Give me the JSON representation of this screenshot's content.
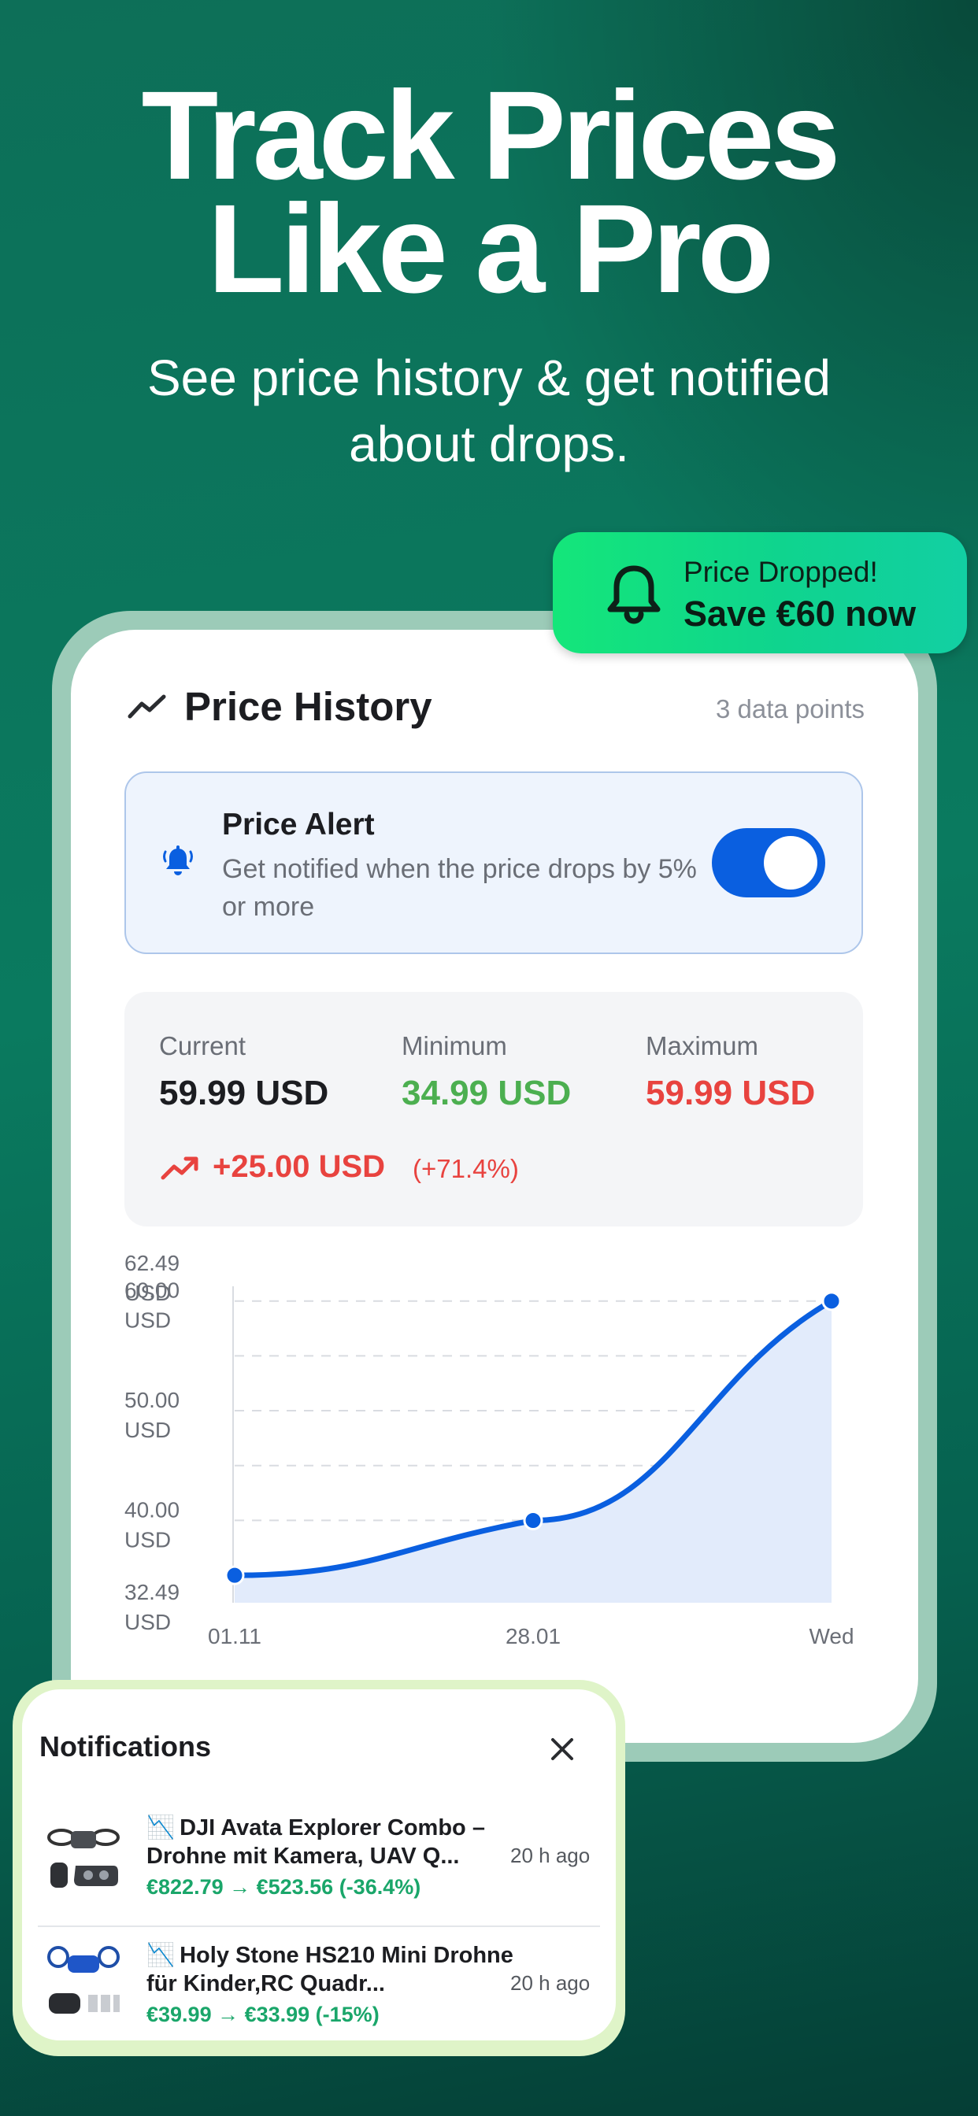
{
  "hero": {
    "title_line1": "Track Prices",
    "title_line2": "Like a Pro",
    "subtitle_line1": "See price history & get notified",
    "subtitle_line2": "about drops."
  },
  "badge": {
    "icon": "bell-icon",
    "line1": "Price Dropped!",
    "line2": "Save €60 now"
  },
  "price_history": {
    "icon": "trend-line-icon",
    "title": "Price History",
    "data_points_label": "3 data points"
  },
  "price_alert": {
    "icon": "bell-ring-icon",
    "title": "Price Alert",
    "description": "Get notified when the price drops by 5% or more",
    "enabled": true
  },
  "stats": {
    "current_label": "Current",
    "current_value": "59.99 USD",
    "minimum_label": "Minimum",
    "minimum_value": "34.99 USD",
    "maximum_label": "Maximum",
    "maximum_value": "59.99 USD",
    "change_icon": "trending-up-icon",
    "change_value": "+25.00 USD",
    "change_percent": "(+71.4%)"
  },
  "colors": {
    "accent_blue": "#0a5fe0",
    "min_green": "#4caf50",
    "max_red": "#e8433f",
    "badge_green": "#14e67a"
  },
  "chart_data": {
    "type": "area",
    "x": [
      "01.11",
      "28.01",
      "Wed"
    ],
    "series": [
      {
        "values": [
          34.99,
          39.99,
          59.99
        ]
      }
    ],
    "y_tick_labels": [
      "62.49 USD",
      "60.00 USD",
      "50.00 USD",
      "40.00 USD",
      "32.49 USD"
    ],
    "y_ticks": [
      62.49,
      60,
      50,
      40,
      32.49
    ],
    "ylim": [
      32.49,
      62.49
    ],
    "grid": true
  },
  "notifications": {
    "title": "Notifications",
    "close_icon": "close-icon",
    "items": [
      {
        "trend_glyph": "📉",
        "name": "DJI Avata Explorer Combo – Drohne mit Kamera, UAV Q...",
        "price": "€822.79 → €523.56 (-36.4%)",
        "time": "20 h ago",
        "thumb_icon": "drone-product-image"
      },
      {
        "trend_glyph": "📉",
        "name": "Holy Stone HS210 Mini Drohne für Kinder,RC Quadr...",
        "price": "€39.99 → €33.99 (-15%)",
        "time": "20 h ago",
        "thumb_icon": "mini-drone-product-image"
      }
    ]
  }
}
